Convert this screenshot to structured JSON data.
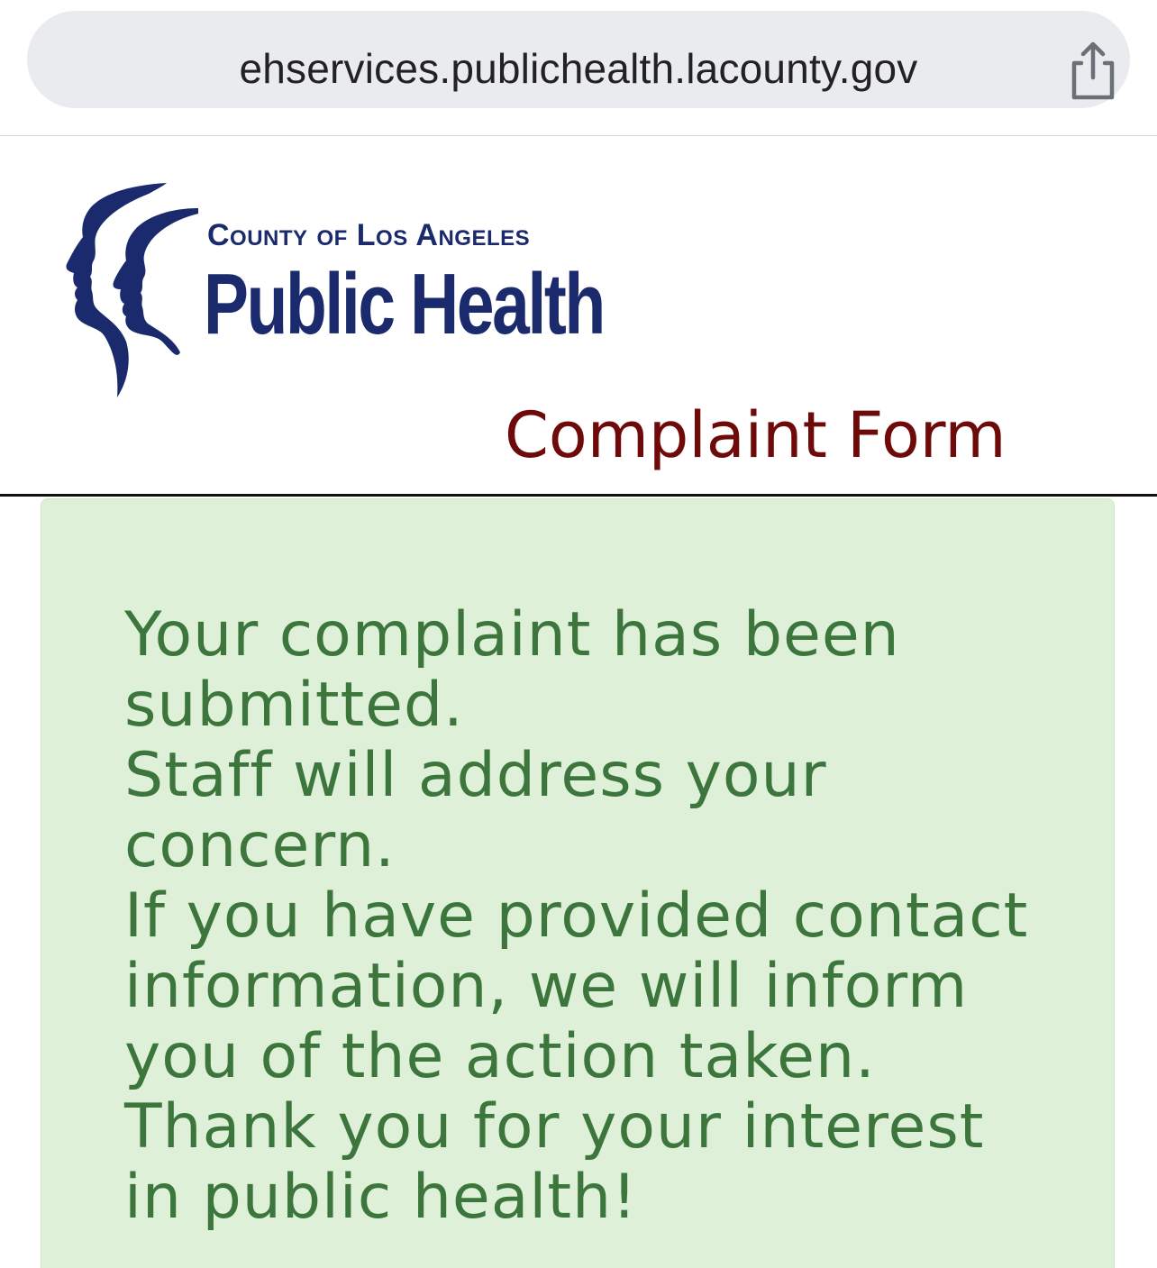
{
  "browser": {
    "url": "ehservices.publichealth.lacounty.gov",
    "share_icon": "share-icon"
  },
  "header": {
    "logo": {
      "county_line": "County of Los Angeles",
      "department_line": "Public Health"
    },
    "title": "Complaint Form"
  },
  "alert": {
    "lines": [
      "Your complaint has been",
      "submitted.",
      "Staff will address your",
      "concern.",
      "If you have provided contact",
      "information, we will inform",
      "you of the action taken.",
      "Thank you for your interest",
      "in public health!"
    ]
  },
  "colors": {
    "title": "#6e0a0a",
    "logo_blue": "#1a2a6c",
    "alert_bg": "#dff0d8",
    "alert_text": "#3c763d"
  }
}
